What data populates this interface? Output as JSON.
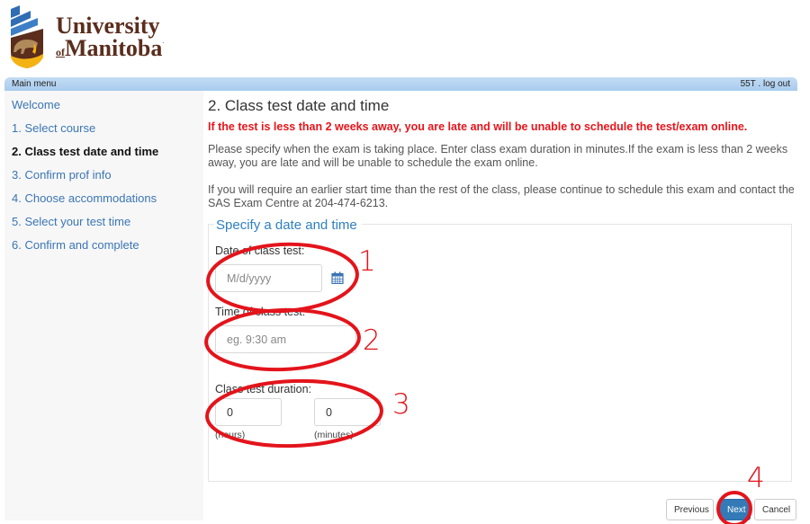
{
  "brand": {
    "line1": "University",
    "line2_prefix": "of",
    "line2": "Manitoba",
    "colors": {
      "text": "#5a2d1c",
      "blue": "#2f6db5",
      "gold": "#f3b315"
    }
  },
  "menubar": {
    "main_menu_label": "Main menu",
    "user_code": "55T",
    "separator": " . ",
    "logout_label": "log out"
  },
  "sidebar": {
    "items": [
      {
        "label": "Welcome",
        "active": false
      },
      {
        "label": "1. Select course",
        "active": false
      },
      {
        "label": "2. Class test date and time",
        "active": true
      },
      {
        "label": "3. Confirm prof info",
        "active": false
      },
      {
        "label": "4. Choose accommodations",
        "active": false
      },
      {
        "label": "5. Select your test time",
        "active": false
      },
      {
        "label": "6. Confirm and complete",
        "active": false
      }
    ]
  },
  "main": {
    "title": "2. Class test date and time",
    "warning": "If the test is less than 2 weeks away, you are late and will be unable to schedule the test/exam online.",
    "paragraph1": "Please specify when the exam is taking place.  Enter class exam duration in minutes.If the exam is less than 2 weeks away, you are late and will be unable to schedule the exam online.",
    "paragraph2": "If you will require an earlier start time than the rest of the class, please continue to schedule this exam and contact the SAS Exam Centre at 204-474-6213.",
    "fieldset": {
      "legend": "Specify a date and time",
      "date_label": "Date of class test:",
      "date_value": "",
      "date_placeholder": "M/d/yyyy",
      "calendar_icon": "calendar-icon",
      "time_label": "Time of class test:",
      "time_value": "",
      "time_placeholder": "eg. 9:30 am",
      "duration_label": "Class test duration:",
      "hours_value": "0",
      "hours_sublabel": "(hours)",
      "minutes_value": "0",
      "minutes_sublabel": "(minutes)"
    }
  },
  "buttons": {
    "previous": "Previous",
    "next": "Next",
    "cancel": "Cancel"
  },
  "annotations": {
    "color": "#e3141b",
    "labels": [
      "1",
      "2",
      "3",
      "4"
    ]
  }
}
